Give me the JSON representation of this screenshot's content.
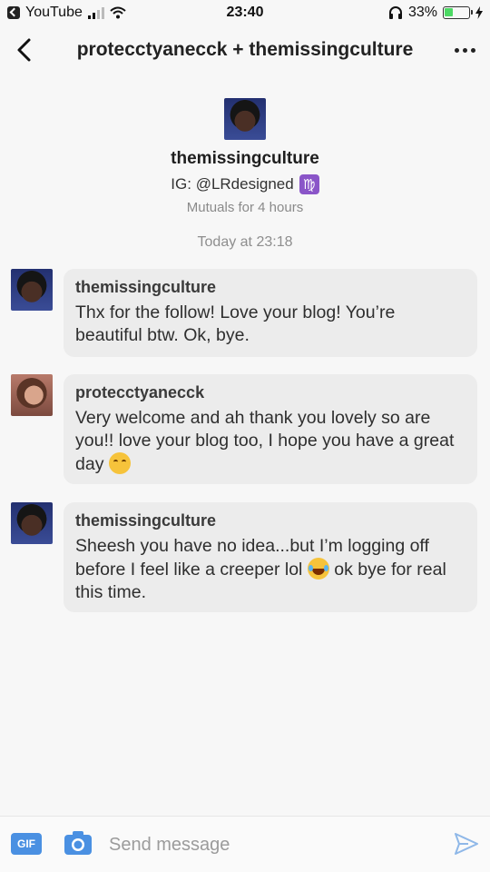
{
  "status_bar": {
    "back_app": "YouTube",
    "time": "23:40",
    "battery": "33%"
  },
  "header": {
    "title": "protecctyanecck + themissingculture"
  },
  "profile": {
    "name": "themissingculture",
    "bio": "IG: @LRdesigned",
    "mutuals": "Mutuals for 4 hours"
  },
  "date_separator": "Today at 23:18",
  "messages": [
    {
      "author": "themissingculture",
      "text": "Thx for the follow! Love your blog! You’re beautiful btw. Ok, bye."
    },
    {
      "author": "protecctyanecck",
      "text": "Very welcome and ah thank you lovely so are you!! love your blog too, I hope you have a great day",
      "emoji": "relieved-face"
    },
    {
      "author": "themissingculture",
      "text_before_emoji": "Sheesh you have no idea...but I’m logging off before I feel like a creeper lol",
      "text_after_emoji": "ok bye for real this time.",
      "emoji": "tears-of-joy-face"
    }
  ],
  "composer": {
    "gif_label": "GIF",
    "placeholder": "Send message"
  },
  "colors": {
    "accent": "#4a90e2",
    "bubble": "#ececec",
    "background": "#f7f7f7"
  }
}
